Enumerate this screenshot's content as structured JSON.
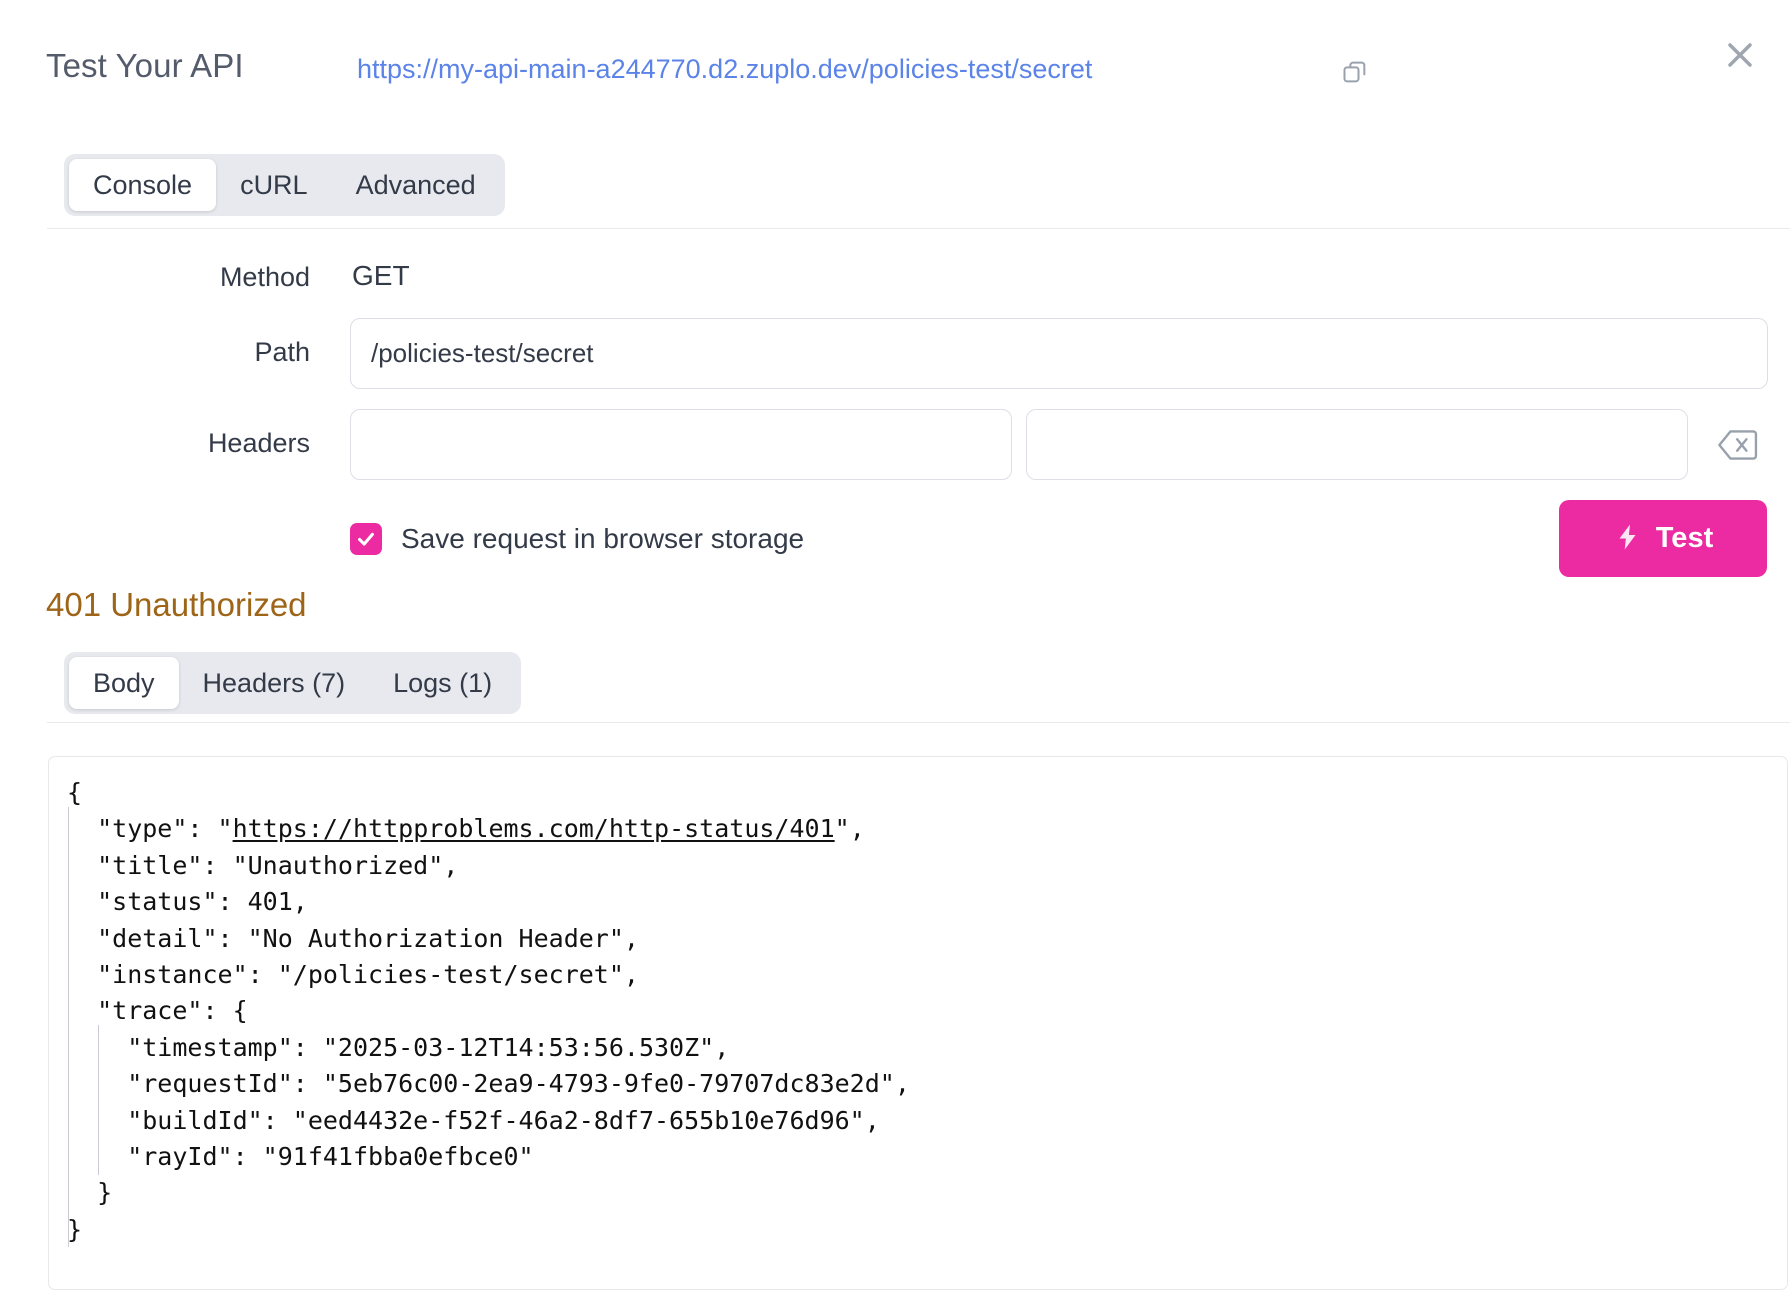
{
  "header": {
    "title": "Test Your API",
    "url": "https://my-api-main-a244770.d2.zuplo.dev/policies-test/secret",
    "copy_icon": "copy-icon",
    "close_icon": "close-icon"
  },
  "request_tabs": [
    {
      "label": "Console",
      "active": true
    },
    {
      "label": "cURL",
      "active": false
    },
    {
      "label": "Advanced",
      "active": false
    }
  ],
  "form": {
    "method_label": "Method",
    "method_value": "GET",
    "path_label": "Path",
    "path_value": "/policies-test/secret",
    "path_placeholder": "",
    "headers_label": "Headers",
    "header_key_value": "",
    "header_key_placeholder": "",
    "header_val_value": "",
    "header_val_placeholder": "",
    "clear_icon": "backspace-clear-icon"
  },
  "save_request": {
    "label": "Save request in browser storage",
    "checked": true,
    "check_icon": "check-icon"
  },
  "test_button": {
    "label": "Test",
    "icon": "lightning-bolt-icon",
    "color": "#ec2ba2"
  },
  "response": {
    "status_text": "401 Unauthorized",
    "status_color": "#9e6518",
    "tabs": [
      {
        "label": "Body",
        "active": true
      },
      {
        "label": "Headers (7)",
        "active": false
      },
      {
        "label": "Logs (1)",
        "active": false
      }
    ],
    "body_lines": [
      "{",
      "  \"type\": \"https://httpproblems.com/http-status/401\",",
      "  \"title\": \"Unauthorized\",",
      "  \"status\": 401,",
      "  \"detail\": \"No Authorization Header\",",
      "  \"instance\": \"/policies-test/secret\",",
      "  \"trace\": {",
      "    \"timestamp\": \"2025-03-12T14:53:56.530Z\",",
      "    \"requestId\": \"5eb76c00-2ea9-4793-9fe0-79707dc83e2d\",",
      "    \"buildId\": \"eed4432e-f52f-46a2-8df7-655b10e76d96\",",
      "    \"rayId\": \"91f41fbba0efbce0\"",
      "  }",
      "}"
    ],
    "body_link": "https://httpproblems.com/http-status/401"
  }
}
